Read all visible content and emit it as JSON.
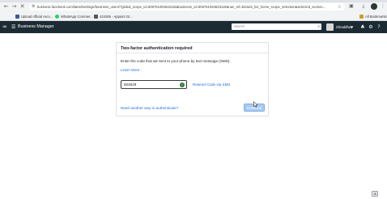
{
  "browser": {
    "url": "business.facebook.com/latest/settings/business_users/?global_scope_id=806761094633118&business_id=806761094633118&nav_ref=bizweb_biz_home_scope_selection&selected_section...",
    "bookmarks": [
      {
        "label": "Upload official reco...",
        "color": "#3b5998"
      },
      {
        "label": "WhatsApp Commer...",
        "color": "#25d366"
      },
      {
        "label": "424265 - Appoint Gr...",
        "color": "#555555"
      }
    ],
    "all_bookmarks": "All Bookmarks",
    "icons": {
      "back": "arrow-left-icon",
      "forward": "arrow-right-icon",
      "stop": "close-icon",
      "site_info": "tune-icon",
      "bookmark": "star-icon",
      "extensions": "puzzle-icon",
      "download": "download-icon",
      "menu": "kebab-menu-icon"
    }
  },
  "app": {
    "title": "Business Manager",
    "search_placeholder": "Search",
    "account_name": "Shraddha",
    "icons": {
      "logo": "meta-logo-icon",
      "apps": "grid-menu-icon",
      "search": "search-icon",
      "notifications": "bell-icon",
      "settings": "gear-icon",
      "help": "help-icon"
    }
  },
  "dialog": {
    "title": "Two-factor authentication required",
    "instruction": "Enter the code that we sent to your phone by text message (SMS).",
    "learn_more": "Learn More",
    "code_value": "604529",
    "resend_label": "Resend Code via SMS",
    "help_link": "Need another way to authenticate?",
    "continue_label": "Continue"
  },
  "colors": {
    "appbar": "#1c2b33",
    "link": "#216fdb",
    "button_disabled": "#a9c9f0",
    "success": "#2e7d32"
  }
}
